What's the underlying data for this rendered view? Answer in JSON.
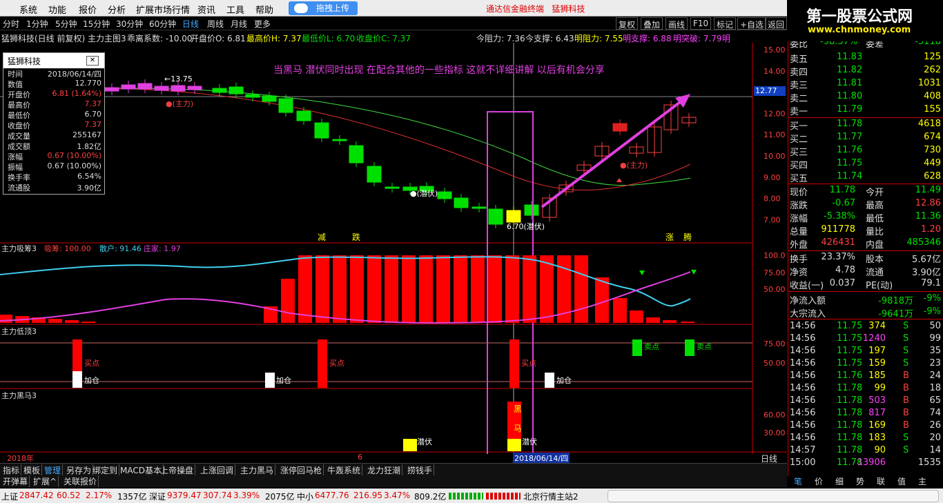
{
  "menu": {
    "items": [
      "系统",
      "功能",
      "报价",
      "分析",
      "扩展市场行情",
      "资讯",
      "工具",
      "帮助"
    ],
    "upload": "拖拽上传",
    "title": "通达信金融终端",
    "stock_name": "猛狮科技"
  },
  "logo": {
    "main": "第一股票公式网",
    "url": "www.chnmoney.com"
  },
  "toolbar": {
    "periods": [
      "分时",
      "1分钟",
      "5分钟",
      "15分钟",
      "30分钟",
      "60分钟",
      "日线",
      "周线",
      "月线",
      "更多"
    ],
    "active": "日线",
    "right": [
      "复权",
      "叠加",
      "画线",
      "F10",
      "标记",
      "+自选",
      "返回"
    ]
  },
  "info": {
    "title": "猛狮科技(日线 前复权) 主力主图3",
    "coef": "乖离系数: -10.00",
    "open": "开盘价O: 6.81",
    "high": "最高价H: 7.37",
    "low": "最低价L: 6.70",
    "close": "收盘价C: 7.37",
    "resist": "今阻力: 7.36",
    "support": "今支撑: 6.43",
    "next_resist": "明阻力: 7.55",
    "next_support": "明支撑: 6.88",
    "break": "明突破: 7.79",
    "more": "明"
  },
  "float_panel": {
    "title": "猛狮科技",
    "rows": [
      {
        "k": "时间",
        "v": "2018/06/14/四",
        "c": "#ddd"
      },
      {
        "k": "数值",
        "v": "12.770",
        "c": "#ddd"
      },
      {
        "k": "开盘价",
        "v": "6.81 (1.64%)",
        "c": "#ff4040"
      },
      {
        "k": "最高价",
        "v": "7.37",
        "c": "#ff4040"
      },
      {
        "k": "最低价",
        "v": "6.70",
        "c": "#ddd"
      },
      {
        "k": "收盘价",
        "v": "7.37",
        "c": "#ff4040"
      },
      {
        "k": "成交量",
        "v": "255167",
        "c": "#ddd"
      },
      {
        "k": "成交额",
        "v": "1.82亿",
        "c": "#ddd"
      },
      {
        "k": "涨幅",
        "v": "0.67 (10.00%)",
        "c": "#ff4040"
      },
      {
        "k": "振幅",
        "v": "0.67 (10.00%)",
        "c": "#ddd"
      },
      {
        "k": "换手率",
        "v": "6.54%",
        "c": "#ddd"
      },
      {
        "k": "流通股",
        "v": "3.90亿",
        "c": "#ddd"
      }
    ]
  },
  "annotation": "当黑马  潜伏同时出现   在配合其他的一些指标  这就不详细讲解  以后有机会分享",
  "main_labels": {
    "high_mark": "13.75",
    "zhuli": "(主力)",
    "qianfu": "(潜伏)",
    "low_mark": "6.70",
    "jian": "减",
    "die": "跌",
    "zhang": "涨",
    "teng": "腾",
    "price_tag": "12.77"
  },
  "price_axis": [
    "15.00",
    "14.00",
    "13.00",
    "12.00",
    "11.00",
    "10.00",
    "9.00",
    "8.00",
    "7.00"
  ],
  "ind1": {
    "name": "主力吸筹3",
    "a": "吸筹: 100.00",
    "b": "散户: 91.46",
    "c": "庄家: 1.97",
    "axis": [
      "100.0",
      "75.00",
      "50.00"
    ]
  },
  "ind2": {
    "name": "主力低顶3",
    "buy": "买点",
    "add": "加仓",
    "sell": "卖点",
    "axis": [
      "75.00",
      "50.00"
    ]
  },
  "ind3": {
    "name": "主力黑马3",
    "hei": "黑",
    "ma": "马",
    "qf": "潜伏",
    "axis": [
      "60.00",
      "30.00"
    ]
  },
  "date_axis": {
    "year": "2018年",
    "m6": "6",
    "cursor": "2018/06/14/四",
    "period": "日线"
  },
  "quote": {
    "top": {
      "k": "委比",
      "v": "-98.37%",
      "k2": "委差",
      "v2": "-5118"
    },
    "sells": [
      {
        "k": "卖五",
        "p": "11.83",
        "v": "125"
      },
      {
        "k": "卖四",
        "p": "11.82",
        "v": "262"
      },
      {
        "k": "卖三",
        "p": "11.81",
        "v": "1031"
      },
      {
        "k": "卖二",
        "p": "11.80",
        "v": "408"
      },
      {
        "k": "卖一",
        "p": "11.79",
        "v": "155"
      }
    ],
    "buys": [
      {
        "k": "买一",
        "p": "11.78",
        "v": "4618"
      },
      {
        "k": "买二",
        "p": "11.77",
        "v": "674"
      },
      {
        "k": "买三",
        "p": "11.76",
        "v": "730"
      },
      {
        "k": "买四",
        "p": "11.75",
        "v": "449"
      },
      {
        "k": "买五",
        "p": "11.74",
        "v": "628"
      }
    ],
    "stats": [
      {
        "k": "现价",
        "v": "11.78",
        "vc": "#00e000",
        "k2": "今开",
        "v2": "11.49",
        "v2c": "#00e000"
      },
      {
        "k": "涨跌",
        "v": "-0.67",
        "vc": "#00e000",
        "k2": "最高",
        "v2": "12.86",
        "v2c": "#ff4040"
      },
      {
        "k": "涨幅",
        "v": "-5.38%",
        "vc": "#00e000",
        "k2": "最低",
        "v2": "11.36",
        "v2c": "#00e000"
      },
      {
        "k": "总量",
        "v": "911778",
        "vc": "#ffff00",
        "k2": "量比",
        "v2": "1.20",
        "v2c": "#ff4040"
      },
      {
        "k": "外盘",
        "v": "426431",
        "vc": "#ff4040",
        "k2": "内盘",
        "v2": "485346",
        "v2c": "#00e000"
      }
    ],
    "stats2": [
      {
        "k": "换手",
        "v": "23.37%",
        "vc": "#ddd",
        "k2": "股本",
        "v2": "5.67亿",
        "v2c": "#ddd"
      },
      {
        "k": "净资",
        "v": "4.78",
        "vc": "#ddd",
        "k2": "流通",
        "v2": "3.90亿",
        "v2c": "#ddd"
      },
      {
        "k": "收益(一)",
        "v": "0.037",
        "vc": "#ddd",
        "k2": "PE(动)",
        "v2": "79.1",
        "v2c": "#ddd"
      }
    ],
    "flow": [
      {
        "k": "净流入额",
        "v": "-9818万",
        "p": "-9%"
      },
      {
        "k": "大宗流入",
        "v": "-9641万",
        "p": "-9%"
      }
    ],
    "ticks": [
      {
        "t": "14:56",
        "p": "11.75",
        "v": "374",
        "vc": "#ffff00",
        "s": "S",
        "n": "50"
      },
      {
        "t": "14:56",
        "p": "11.75",
        "v": "1240",
        "vc": "#ff40ff",
        "s": "S",
        "n": "99"
      },
      {
        "t": "14:56",
        "p": "11.75",
        "v": "197",
        "vc": "#ffff00",
        "s": "S",
        "n": "35"
      },
      {
        "t": "14:56",
        "p": "11.75",
        "v": "159",
        "vc": "#ffff00",
        "s": "S",
        "n": "23"
      },
      {
        "t": "14:56",
        "p": "11.76",
        "v": "185",
        "vc": "#ffff00",
        "s": "B",
        "n": "24"
      },
      {
        "t": "14:56",
        "p": "11.78",
        "v": "99",
        "vc": "#ffff00",
        "s": "B",
        "n": "18"
      },
      {
        "t": "14:56",
        "p": "11.78",
        "v": "503",
        "vc": "#ff40ff",
        "s": "B",
        "n": "65"
      },
      {
        "t": "14:56",
        "p": "11.78",
        "v": "817",
        "vc": "#ff40ff",
        "s": "B",
        "n": "74"
      },
      {
        "t": "14:56",
        "p": "11.78",
        "v": "169",
        "vc": "#ffff00",
        "s": "B",
        "n": "26"
      },
      {
        "t": "14:56",
        "p": "11.78",
        "v": "183",
        "vc": "#ffff00",
        "s": "S",
        "n": "20"
      },
      {
        "t": "14:57",
        "p": "11.78",
        "v": "90",
        "vc": "#ffff00",
        "s": "S",
        "n": "14"
      },
      {
        "t": "15:00",
        "p": "11.78",
        "v": "13906",
        "vc": "#ff40ff",
        "s": "",
        "n": "1535"
      }
    ],
    "tabs": [
      "笔",
      "价",
      "细",
      "势",
      "联",
      "值",
      "主"
    ]
  },
  "bottom_tabs": [
    "指标",
    "模板",
    "管理",
    "另存为",
    "绑定到",
    "MACD基本",
    "上帝操盘",
    "上涨回调",
    "主力黑马",
    "涨停回马枪",
    "牛轰系统",
    "龙力狂潮",
    "捞钱手"
  ],
  "bottom_tabs2": [
    "开弹幕",
    "扩展^",
    "关联报价"
  ],
  "status": {
    "sh_k": "上证",
    "sh_v": "2847.42",
    "sh_c": "60.52",
    "sh_p": "2.17%",
    "sh_a": "1357亿",
    "sz_k": "深证",
    "sz_v": "9379.47",
    "sz_c": "307.74",
    "sz_p": "3.39%",
    "sz_a": "2075亿",
    "zx_k": "中小",
    "zx_v": "6477.76",
    "zx_c": "216.95",
    "zx_p": "3.47%",
    "zx_a": "809.2亿",
    "server": "北京行情主站2"
  }
}
